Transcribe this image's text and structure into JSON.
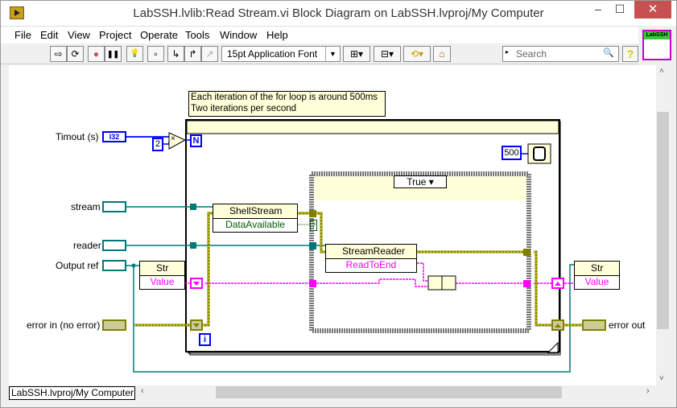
{
  "window": {
    "title": "LabSSH.lvlib:Read Stream.vi Block Diagram on LabSSH.lvproj/My Computer",
    "minimize": "‒",
    "maximize": "☐",
    "close": "✕"
  },
  "menu": [
    "File",
    "Edit",
    "View",
    "Project",
    "Operate",
    "Tools",
    "Window",
    "Help"
  ],
  "toolbar": {
    "run_icon": "⇨",
    "run_continuous_icon": "⟳",
    "abort_icon": "●",
    "pause_icon": "❚❚",
    "highlight_icon": "💡",
    "font_label": "15pt Application Font",
    "font_dropdown": "▼",
    "search_placeholder": "Search",
    "search_icon": "🔍",
    "help_icon": "?",
    "vi_icon_label": "LabSSH"
  },
  "diagram": {
    "comment_line1": "Each iteration of the for loop is around 500ms",
    "comment_line2": "Two iterations per second",
    "controls": {
      "timeout_label": "Timout (s)",
      "timeout_type": "I32",
      "stream_label": "stream",
      "reader_label": "reader",
      "output_ref_label": "Output ref",
      "error_in_label": "error in (no error)",
      "error_out_label": "error out"
    },
    "constants": {
      "multiplier": "2",
      "wait_ms": "500",
      "loop_count": "N",
      "iteration": "i"
    },
    "multiply_symbol": "×",
    "nodes": {
      "shellstream_class": "ShellStream",
      "shellstream_prop": "DataAvailable",
      "streamreader_class": "StreamReader",
      "streamreader_method": "ReadToEnd",
      "str_read_class": "Str",
      "str_read_prop": "Value",
      "str_write_class": "Str",
      "str_write_prop": "Value"
    },
    "case_selector": "True",
    "case_bool_terminal": "?"
  },
  "statusbar": {
    "context": "LabSSH.lvproj/My Computer"
  },
  "colors": {
    "refnum_wire": "#007878",
    "int_wire": "#0000ff",
    "string_wire": "#ff00ff",
    "error_wire": "#808000",
    "close_button": "#c75050"
  }
}
